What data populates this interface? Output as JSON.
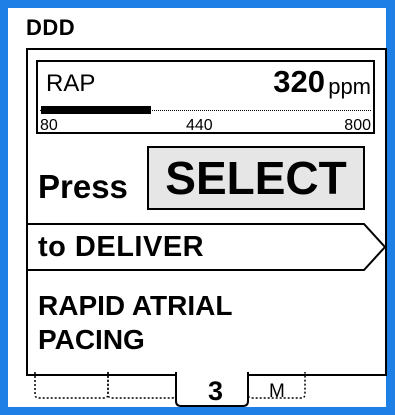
{
  "header": {
    "mode": "DDD"
  },
  "rate_display": {
    "mode": "RAP",
    "value": "320",
    "unit": "ppm",
    "scale": {
      "min": "80",
      "mid": "440",
      "max": "800"
    },
    "level_fraction": 0.3333
  },
  "prompt": {
    "press": "Press",
    "select_key": "SELECT",
    "deliver": "to  DELIVER"
  },
  "therapy": {
    "name": "RAPID ATRIAL PACING"
  },
  "soft_keys": {
    "page_number": "3",
    "menu_glyph": "M"
  }
}
